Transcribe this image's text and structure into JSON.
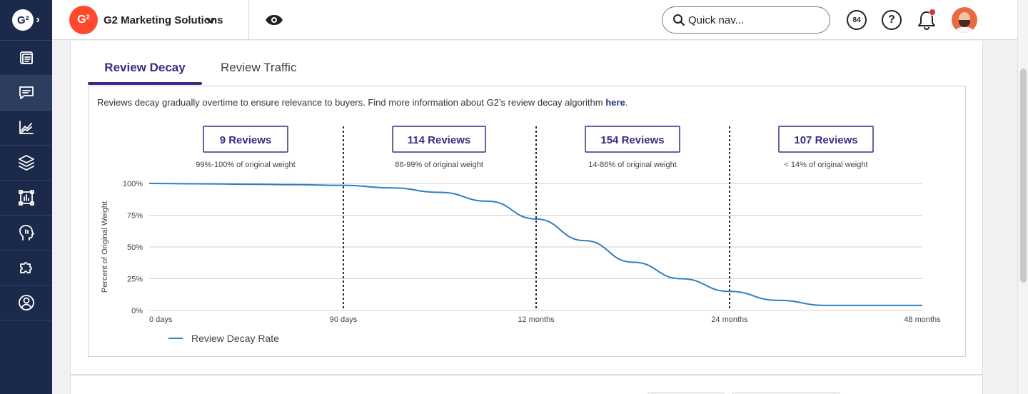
{
  "app": {
    "logo_text": "G²",
    "workspace_logo_text": "G²"
  },
  "rail": {
    "items": [
      {
        "icon": "dashboard-icon"
      },
      {
        "icon": "reviews-chat-icon",
        "active": true
      },
      {
        "icon": "analytics-chart-icon"
      },
      {
        "icon": "layers-icon"
      },
      {
        "icon": "report-frame-icon"
      },
      {
        "icon": "head-profile-icon"
      },
      {
        "icon": "puzzle-integrations-icon"
      },
      {
        "icon": "account-user-icon"
      }
    ]
  },
  "header": {
    "workspace_name": "G2 Marketing Solutions",
    "search_placeholder": "Quick nav...",
    "score_badge": "84",
    "help_label": "?"
  },
  "tabs": [
    {
      "label": "Review Decay",
      "active": true
    },
    {
      "label": "Review Traffic",
      "active": false
    }
  ],
  "intro": {
    "text": "Reviews decay gradually overtime to ensure relevance to buyers. Find more information about G2’s review decay algorithm ",
    "link": "here",
    "suffix": "."
  },
  "chart_data": {
    "type": "line",
    "title": "",
    "xlabel": "",
    "ylabel": "Percent of Original Weight",
    "ylim": [
      0,
      100
    ],
    "y_ticks": [
      "100%",
      "75%",
      "50%",
      "25%",
      "0%"
    ],
    "x_ticks": [
      "0 days",
      "90 days",
      "12 months",
      "24 months",
      "48 months"
    ],
    "grid": true,
    "legend_position": "bottom-left",
    "series": [
      {
        "name": "Review Decay Rate",
        "color": "#2f7fc1",
        "x": [
          0,
          0.25,
          0.5,
          0.75,
          1,
          1.25,
          1.5,
          1.75,
          2,
          2.25,
          2.5,
          2.75,
          3,
          3.25,
          3.5,
          4
        ],
        "y": [
          100,
          99.7,
          99.4,
          99,
          98.5,
          96.5,
          93,
          86,
          72,
          55,
          38,
          25,
          15,
          8,
          4,
          4
        ]
      }
    ],
    "bands": [
      {
        "label": "9 Reviews",
        "caption": "99%-100% of original weight"
      },
      {
        "label": "114 Reviews",
        "caption": "86-99% of original weight"
      },
      {
        "label": "154 Reviews",
        "caption": "14-86% of original weight"
      },
      {
        "label": "107 Reviews",
        "caption": "< 14% of original weight"
      }
    ],
    "accent_color": "#3b2b84"
  }
}
